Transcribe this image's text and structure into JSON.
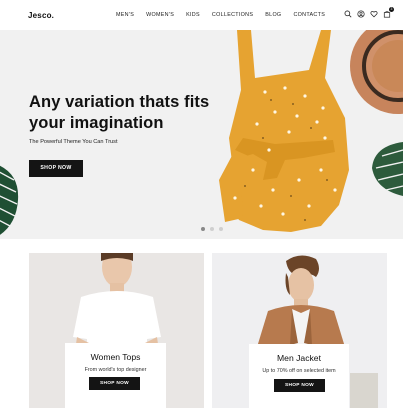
{
  "header": {
    "logo": "Jesco.",
    "nav": [
      "MEN'S",
      "WOMEN'S",
      "KIDS",
      "COLLECTIONS",
      "BLOG",
      "CONTACTS"
    ],
    "icons": [
      "search-icon",
      "user-icon",
      "heart-icon",
      "cart-icon"
    ],
    "cart_count": "3"
  },
  "hero": {
    "title": "Any variation thats fits your imagination",
    "subtitle": "The Powerful Theme You Can Trust",
    "button": "SHOP NOW",
    "slides_count": 3,
    "active_slide": 1
  },
  "promos": [
    {
      "title": "Women Tops",
      "subtitle": "From world's top designer",
      "button": "SHOP NOW"
    },
    {
      "title": "Men Jacket",
      "subtitle": "Up to 70% off on selected item",
      "button": "SHOP NOW"
    }
  ],
  "colors": {
    "accent": "#141414",
    "hero_bg": "#f1f1f1",
    "dress": "#e6a331",
    "women_card_bg": "#e9e6e4",
    "men_card_bg": "#efeff1"
  }
}
